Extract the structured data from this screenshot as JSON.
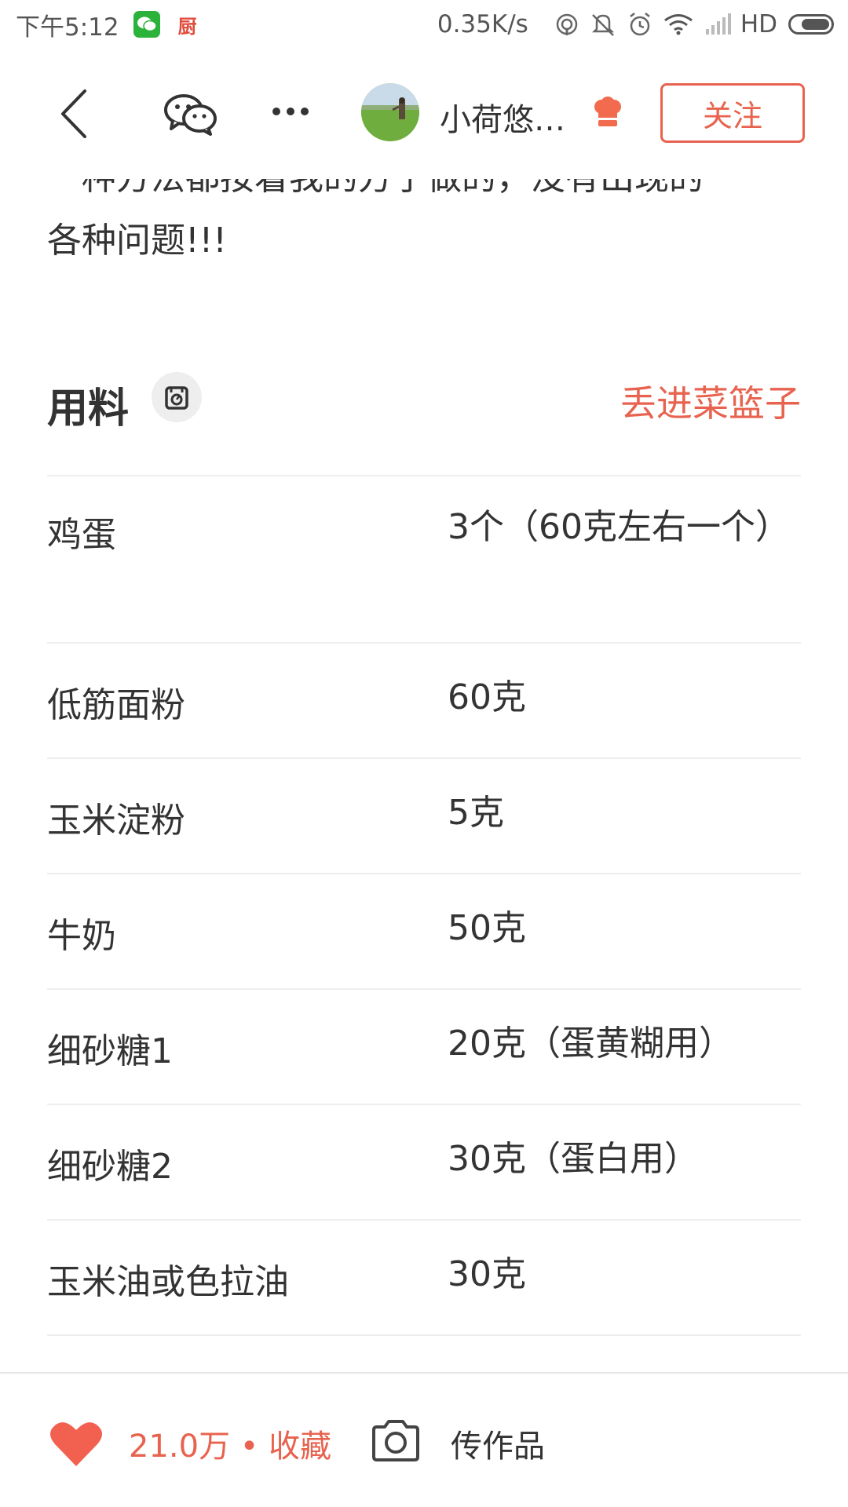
{
  "status_bar": {
    "time": "下午5:12",
    "kitchen_glyph": "厨",
    "net_speed": "0.35K/s",
    "network_label": "HD",
    "battery_level": 0.75,
    "icons": [
      "wechat-icon",
      "kitchen-app-icon",
      "hotspot-icon",
      "mute-icon",
      "alarm-icon",
      "wifi-icon",
      "signal-icon",
      "battery-icon"
    ]
  },
  "nav": {
    "author_name": "小荷悠…",
    "follow_label": "关注",
    "icons": [
      "back-icon",
      "wechat-share-icon",
      "more-icon",
      "avatar",
      "chef-badge-icon"
    ]
  },
  "intro": {
    "partial_line": "一种方法都按着我的方子做的，没有出现的",
    "tail": "各种问题!!!"
  },
  "ingredients": {
    "title": "用料",
    "basket_label": "丢进菜篮子",
    "items": [
      {
        "name": "鸡蛋",
        "amount": "3个（60克左右一个）"
      },
      {
        "name": "低筋面粉",
        "amount": "60克"
      },
      {
        "name": "玉米淀粉",
        "amount": "5克"
      },
      {
        "name": "牛奶",
        "amount": "50克"
      },
      {
        "name": "细砂糖1",
        "amount": "20克（蛋黄糊用）"
      },
      {
        "name": "细砂糖2",
        "amount": "30克（蛋白用）"
      },
      {
        "name": "玉米油或色拉油",
        "amount": "30克"
      }
    ]
  },
  "bottom_bar": {
    "favorites": "21.0万 • 收藏",
    "upload_label": "传作品"
  },
  "colors": {
    "accent": "#e8634f",
    "text": "#333333",
    "divider": "#eeeeee"
  }
}
